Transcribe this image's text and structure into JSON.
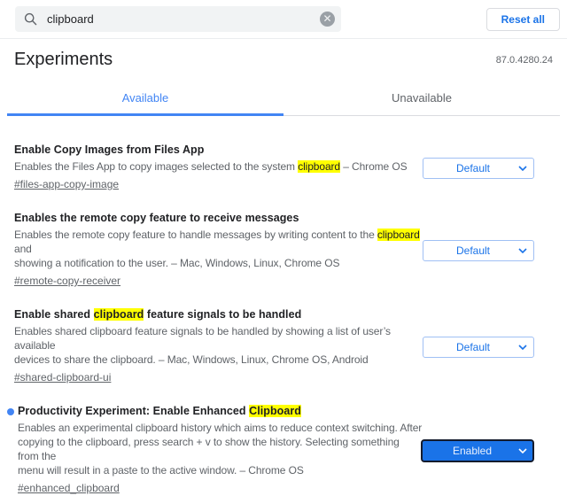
{
  "header": {
    "search": {
      "value": "clipboard"
    },
    "clear_label": "✕",
    "reset_all_label": "Reset all"
  },
  "page": {
    "title": "Experiments",
    "version": "87.0.4280.24"
  },
  "tabs": [
    {
      "label": "Available",
      "active": true
    },
    {
      "label": "Unavailable",
      "active": false
    }
  ],
  "experiments": [
    {
      "title_segments": [
        {
          "t": "Enable Copy Images from Files App"
        }
      ],
      "desc_segments": [
        {
          "t": "Enables the Files App to copy images selected to the system "
        },
        {
          "t": "clipboard",
          "hl": true
        },
        {
          "t": " – Chrome OS"
        }
      ],
      "link": "#files-app-copy-image",
      "select_value": "Default",
      "modified": false
    },
    {
      "title_segments": [
        {
          "t": "Enables the remote copy feature to receive messages"
        }
      ],
      "desc_segments": [
        {
          "t": "Enables the remote copy feature to handle messages by writing content to the "
        },
        {
          "t": "clipboard",
          "hl": true
        },
        {
          "t": " and"
        },
        {
          "br": true
        },
        {
          "t": "showing a notification to the user. – Mac, Windows, Linux, Chrome OS"
        }
      ],
      "link": "#remote-copy-receiver",
      "select_value": "Default",
      "modified": false
    },
    {
      "title_segments": [
        {
          "t": "Enable shared "
        },
        {
          "t": "clipboard",
          "hl": true
        },
        {
          "t": " feature signals to be handled"
        }
      ],
      "desc_segments": [
        {
          "t": "Enables shared clipboard feature signals to be handled by showing a list of user’s available"
        },
        {
          "br": true
        },
        {
          "t": "devices to share the clipboard. – Mac, Windows, Linux, Chrome OS, Android"
        }
      ],
      "link": "#shared-clipboard-ui",
      "select_value": "Default",
      "modified": false
    },
    {
      "title_segments": [
        {
          "t": "Productivity Experiment: Enable Enhanced "
        },
        {
          "t": "Clipboard",
          "hl": true
        }
      ],
      "desc_segments": [
        {
          "t": "Enables an experimental clipboard history which aims to reduce context switching. After"
        },
        {
          "br": true
        },
        {
          "t": "copying to the clipboard, press search + v to show the history. Selecting something from the"
        },
        {
          "br": true
        },
        {
          "t": "menu will result in a paste to the active window. – Chrome OS"
        }
      ],
      "link": "#enhanced_clipboard",
      "select_value": "Enabled",
      "modified": true
    }
  ],
  "colors": {
    "accent_blue": "#1a73e8",
    "tab_blue": "#4285f4",
    "highlight_yellow": "#ffff00",
    "text_primary": "#202124",
    "text_secondary": "#5f6368",
    "enabled_select_bg": "#1a73e8",
    "search_field_bg": "#f1f3f4"
  }
}
